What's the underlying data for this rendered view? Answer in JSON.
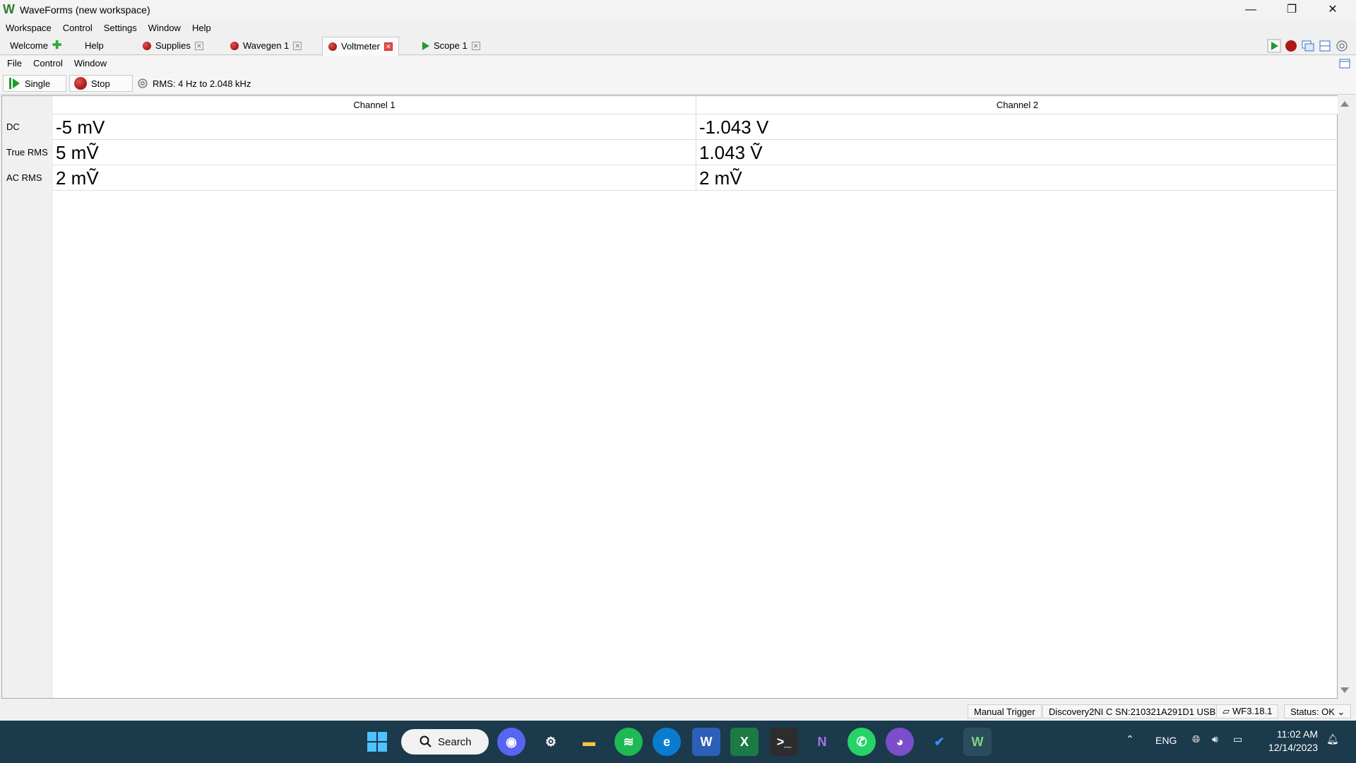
{
  "window": {
    "title": "WaveForms (new workspace)",
    "minimize": "—",
    "restore": "❐",
    "close": "✕"
  },
  "main_menu": [
    "Workspace",
    "Control",
    "Settings",
    "Window",
    "Help"
  ],
  "tabs": [
    {
      "label": "Welcome",
      "icon": "plus-icon",
      "active": false
    },
    {
      "label": "Help",
      "icon": "",
      "active": false
    },
    {
      "label": "Supplies",
      "icon": "record-dot-icon",
      "active": false
    },
    {
      "label": "Wavegen 1",
      "icon": "record-dot-icon",
      "active": false
    },
    {
      "label": "Voltmeter",
      "icon": "record-dot-icon",
      "active": true
    },
    {
      "label": "Scope 1",
      "icon": "play-icon",
      "active": false
    }
  ],
  "sub_menu": [
    "File",
    "Control",
    "Window"
  ],
  "toolbar": {
    "single_label": "Single",
    "stop_label": "Stop",
    "rms_info": "RMS: 4 Hz to 2.048 kHz"
  },
  "table": {
    "columns": [
      "Channel 1",
      "Channel 2"
    ],
    "rows": [
      {
        "label": "DC",
        "values": [
          "-5 mV",
          "-1.043 V"
        ]
      },
      {
        "label": "True RMS",
        "values": [
          "5 mṼ",
          "1.043 Ṽ"
        ]
      },
      {
        "label": "AC RMS",
        "values": [
          "2 mṼ",
          "2 mṼ"
        ]
      }
    ]
  },
  "statusbar": {
    "trigger": "Manual Trigger",
    "device": "Discovery2NI C SN:210321A291D1 USB",
    "version": "WF3.18.1",
    "status": "Status: OK"
  },
  "taskbar": {
    "search_label": "Search",
    "language": "ENG",
    "time": "11:02 AM",
    "date": "12/14/2023"
  }
}
